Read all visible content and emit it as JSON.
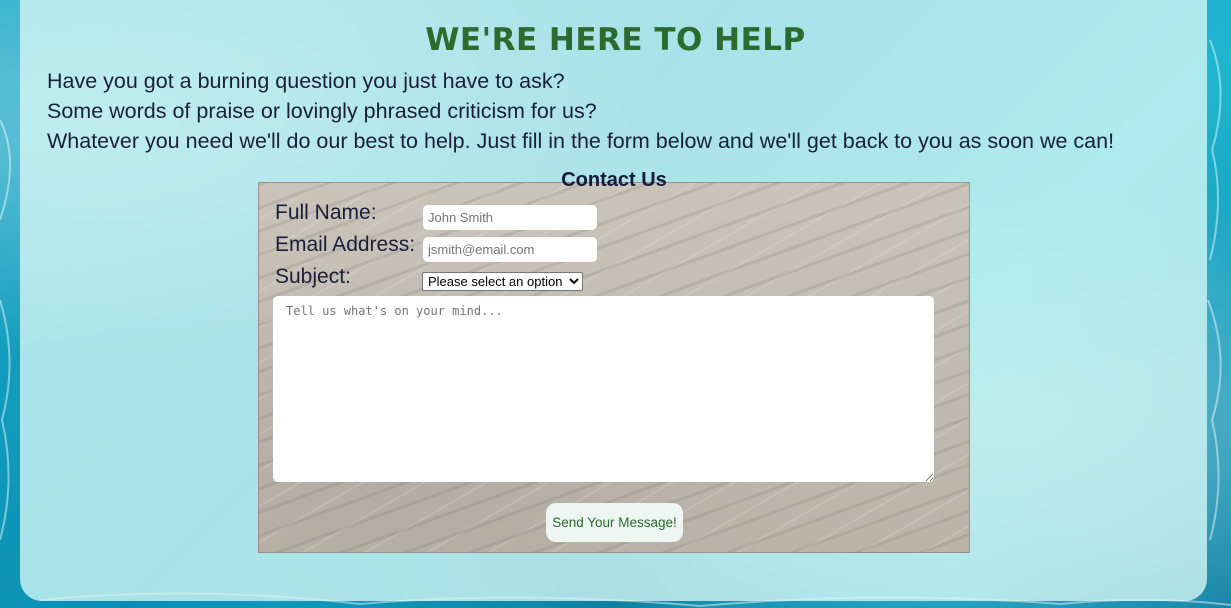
{
  "page": {
    "heading": "WE'RE HERE TO HELP",
    "intro_lines": [
      "Have you got a burning question you just have to ask?",
      "Some words of praise or lovingly phrased criticism for us?",
      "Whatever you need we'll do our best to help. Just fill in the form below and we'll get back to you as soon we can!"
    ]
  },
  "contact_form": {
    "title": "Contact Us",
    "full_name_label": "Full Name:",
    "full_name_placeholder": "John Smith",
    "email_label": "Email Address:",
    "email_placeholder": "jsmith@email.com",
    "subject_label": "Subject:",
    "subject_selected": "Please select an option",
    "message_placeholder": "Tell us what's on your mind...",
    "submit_label": "Send Your Message!"
  },
  "colors": {
    "heading": "#2d6a2d",
    "body_text": "#1a1f3a",
    "panel": "#d7f8f7",
    "water": "#19a9c7",
    "sand": "#c4bdb3",
    "button_text": "#2a6a2a"
  }
}
